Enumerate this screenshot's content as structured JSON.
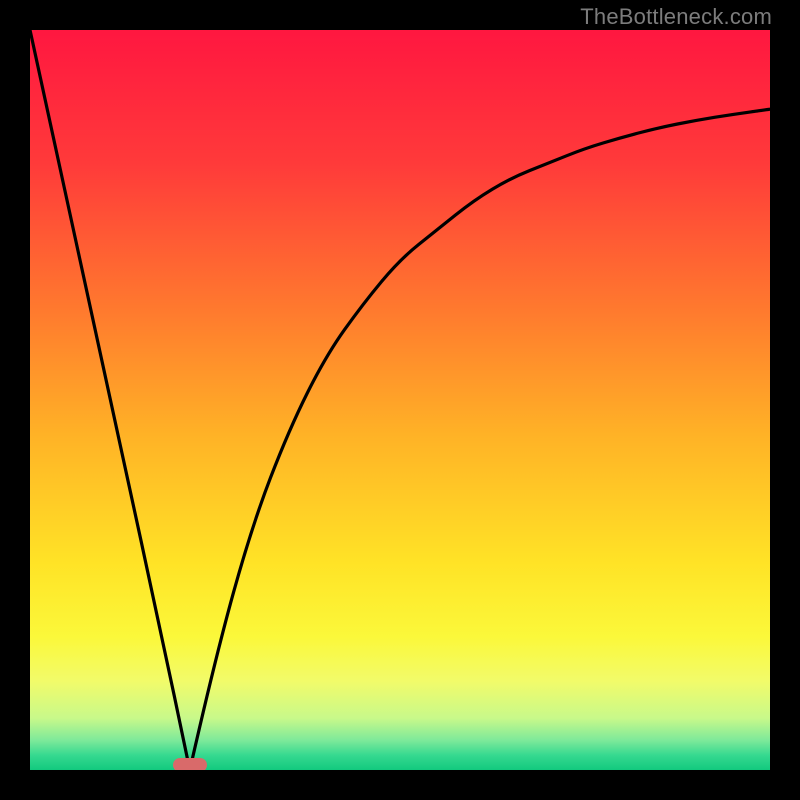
{
  "watermark": {
    "text": "TheBottleneck.com"
  },
  "marker": {
    "x_pct": 21.6,
    "y_pct": 99.3,
    "color": "#d96a6a"
  },
  "gradient": {
    "stops": [
      {
        "offset": "0%",
        "color": "#ff1740"
      },
      {
        "offset": "18%",
        "color": "#ff3a3a"
      },
      {
        "offset": "38%",
        "color": "#ff7a2e"
      },
      {
        "offset": "55%",
        "color": "#ffb326"
      },
      {
        "offset": "72%",
        "color": "#ffe326"
      },
      {
        "offset": "82%",
        "color": "#fbf83a"
      },
      {
        "offset": "88%",
        "color": "#f2fb6a"
      },
      {
        "offset": "93%",
        "color": "#c8f98a"
      },
      {
        "offset": "96%",
        "color": "#7de99a"
      },
      {
        "offset": "98%",
        "color": "#36d990"
      },
      {
        "offset": "100%",
        "color": "#12c97e"
      }
    ]
  },
  "chart_data": {
    "type": "line",
    "title": "",
    "xlabel": "",
    "ylabel": "",
    "xlim": [
      0,
      100
    ],
    "ylim": [
      0,
      100
    ],
    "note": "V-shaped bottleneck curve. Left branch is a straight line from top-left down to the minimum; right branch rises as a saturating curve toward the upper-right. Values below are approximate readings (percent of plot width/height).",
    "series": [
      {
        "name": "left-branch",
        "x": [
          0,
          5,
          10,
          15,
          19.5,
          21.6
        ],
        "y": [
          100,
          77,
          54,
          31,
          10,
          0
        ]
      },
      {
        "name": "right-branch",
        "x": [
          21.6,
          25,
          30,
          35,
          40,
          45,
          50,
          55,
          60,
          65,
          70,
          75,
          80,
          85,
          90,
          95,
          100
        ],
        "y": [
          0,
          15,
          33,
          46,
          56,
          63,
          69,
          73,
          77,
          80,
          82,
          84,
          85.5,
          86.8,
          87.8,
          88.6,
          89.3
        ]
      }
    ],
    "minimum_point": {
      "x": 21.6,
      "y": 0
    }
  }
}
